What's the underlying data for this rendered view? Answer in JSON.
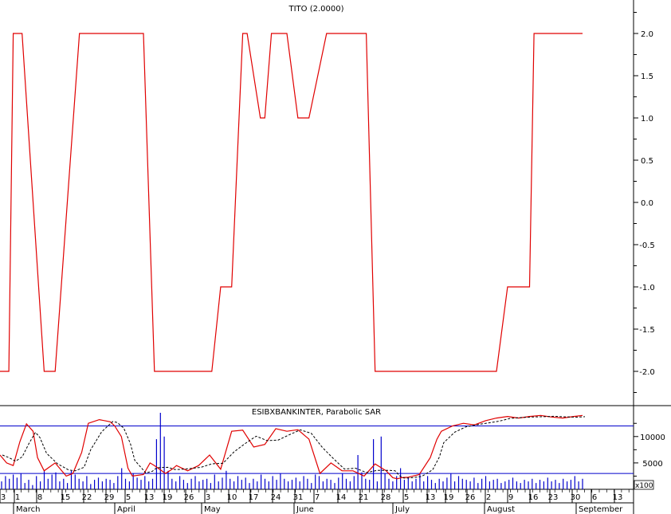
{
  "chart_data": [
    {
      "type": "line",
      "title": "TITO (2.0000)",
      "ylim": [
        -2.5,
        2.5
      ],
      "yticks": [
        "2.0",
        "1.5",
        "1.0",
        "0.5",
        "0.0",
        "-0.5",
        "-1.0",
        "-1.5",
        "-2.0"
      ],
      "ytick_values": [
        2.0,
        1.5,
        1.0,
        0.5,
        0.0,
        -0.5,
        -1.0,
        -1.5,
        -2.0
      ],
      "series": [
        {
          "color": "#e00000",
          "x": [
            0,
            4,
            6,
            10,
            20,
            25,
            36,
            40,
            65,
            70,
            80,
            90,
            96,
            100,
            105,
            110,
            112,
            118,
            120,
            123,
            130,
            135,
            140,
            148,
            150,
            160,
            166,
            170,
            175,
            180,
            198,
            218,
            225,
            230,
            240,
            242,
            245,
            250,
            264
          ],
          "values": [
            -2,
            -2,
            2,
            2,
            -2,
            -2,
            2,
            2,
            2,
            -2,
            -2,
            -2,
            -2,
            -1,
            -1,
            2,
            2,
            1,
            1,
            2,
            2,
            1,
            1,
            2,
            2,
            2,
            2,
            -2,
            -2,
            -2,
            -2,
            -2,
            -2,
            -1,
            -1,
            2,
            2,
            2,
            2
          ]
        }
      ]
    },
    {
      "type": "line",
      "title": "ESIBXBANKINTER, Parabolic SAR",
      "ylim": [
        0,
        14000
      ],
      "yticks": [
        "10000",
        "5000"
      ],
      "ytick_values": [
        10000,
        5000
      ],
      "scale_label": "x100",
      "reference_lines": [
        12000,
        3000
      ],
      "series": [
        {
          "color": "#e00000",
          "x": [
            0,
            3,
            6,
            9,
            12,
            15,
            17,
            20,
            25,
            30,
            33,
            37,
            40,
            45,
            50,
            52,
            55,
            58,
            60,
            65,
            68,
            70,
            75,
            78,
            80,
            85,
            90,
            95,
            100,
            105,
            110,
            115,
            120,
            125,
            130,
            135,
            140,
            145,
            150,
            155,
            160,
            165,
            170,
            175,
            178,
            180,
            182,
            185,
            190,
            195,
            198,
            200,
            205,
            210,
            215,
            220,
            225,
            230,
            235,
            240,
            245,
            250,
            255,
            260,
            264
          ],
          "values": [
            6500,
            5000,
            4500,
            9000,
            12400,
            11000,
            6000,
            3500,
            5000,
            2500,
            3000,
            7000,
            12500,
            13200,
            12800,
            12000,
            10000,
            4000,
            2500,
            2800,
            5000,
            4500,
            3000,
            3800,
            4500,
            3500,
            4500,
            6500,
            3800,
            11000,
            11200,
            8000,
            8500,
            11500,
            11000,
            11300,
            9500,
            3000,
            5000,
            3500,
            3500,
            2500,
            4800,
            3500,
            2200,
            2000,
            2200,
            2300,
            2800,
            6000,
            9500,
            11000,
            12000,
            12500,
            12200,
            13000,
            13500,
            13800,
            13500,
            13800,
            14000,
            13700,
            13500,
            13800,
            14000
          ]
        }
      ],
      "volume": [
        1500,
        2500,
        2000,
        2800,
        2200,
        3000,
        1200,
        1800,
        800,
        2500,
        1500,
        3500,
        2000,
        2800,
        3200,
        1500,
        2000,
        1200,
        3500,
        2800,
        2000,
        1500,
        2500,
        1000,
        1800,
        2200,
        1500,
        2000,
        1800,
        1200,
        2500,
        4000,
        2000,
        1500,
        3000,
        2200,
        1800,
        2500,
        1500,
        2000,
        9500,
        14500,
        10000,
        3500,
        2000,
        1500,
        2500,
        1800,
        1200,
        2000,
        2500,
        1500,
        1800,
        2000,
        1200,
        2800,
        1500,
        2200,
        3500,
        2000,
        1500,
        2500,
        1800,
        2200,
        1200,
        2000,
        1500,
        2800,
        2000,
        1500,
        2500,
        1800,
        3000,
        2000,
        1500,
        1800,
        2200,
        1500,
        2500,
        2000,
        1200,
        2800,
        2500,
        1500,
        2000,
        1800,
        1200,
        2200,
        3000,
        2000,
        1500,
        2500,
        6500,
        3200,
        2000,
        1800,
        9500,
        1500,
        10000,
        3000,
        2000,
        1500,
        2500,
        4000,
        1800,
        2200,
        1500,
        2000,
        3000,
        1500,
        2500,
        1800,
        1200,
        2000,
        1500,
        2200,
        3000,
        1500,
        2500,
        2000,
        1800,
        1500,
        2200,
        1200,
        2000,
        2500,
        1500,
        1800,
        2000,
        1200,
        1500,
        1800,
        2200,
        1500,
        1200,
        1800,
        1500,
        2000,
        1200,
        1800,
        1500,
        2200,
        1500,
        1800,
        1200,
        2000,
        1500,
        1800,
        2500,
        1500,
        2000
      ]
    }
  ],
  "x_axis": {
    "day_labels": [
      "3",
      "1",
      "8",
      "15",
      "22",
      "29",
      "5",
      "13",
      "19",
      "26",
      "3",
      "10",
      "17",
      "24",
      "31",
      "7",
      "14",
      "21",
      "28",
      "5",
      "13",
      "19",
      "26",
      "2",
      "9",
      "16",
      "23",
      "30",
      "6",
      "13"
    ],
    "month_labels": [
      "March",
      "April",
      "May",
      "June",
      "July",
      "August",
      "September"
    ]
  }
}
